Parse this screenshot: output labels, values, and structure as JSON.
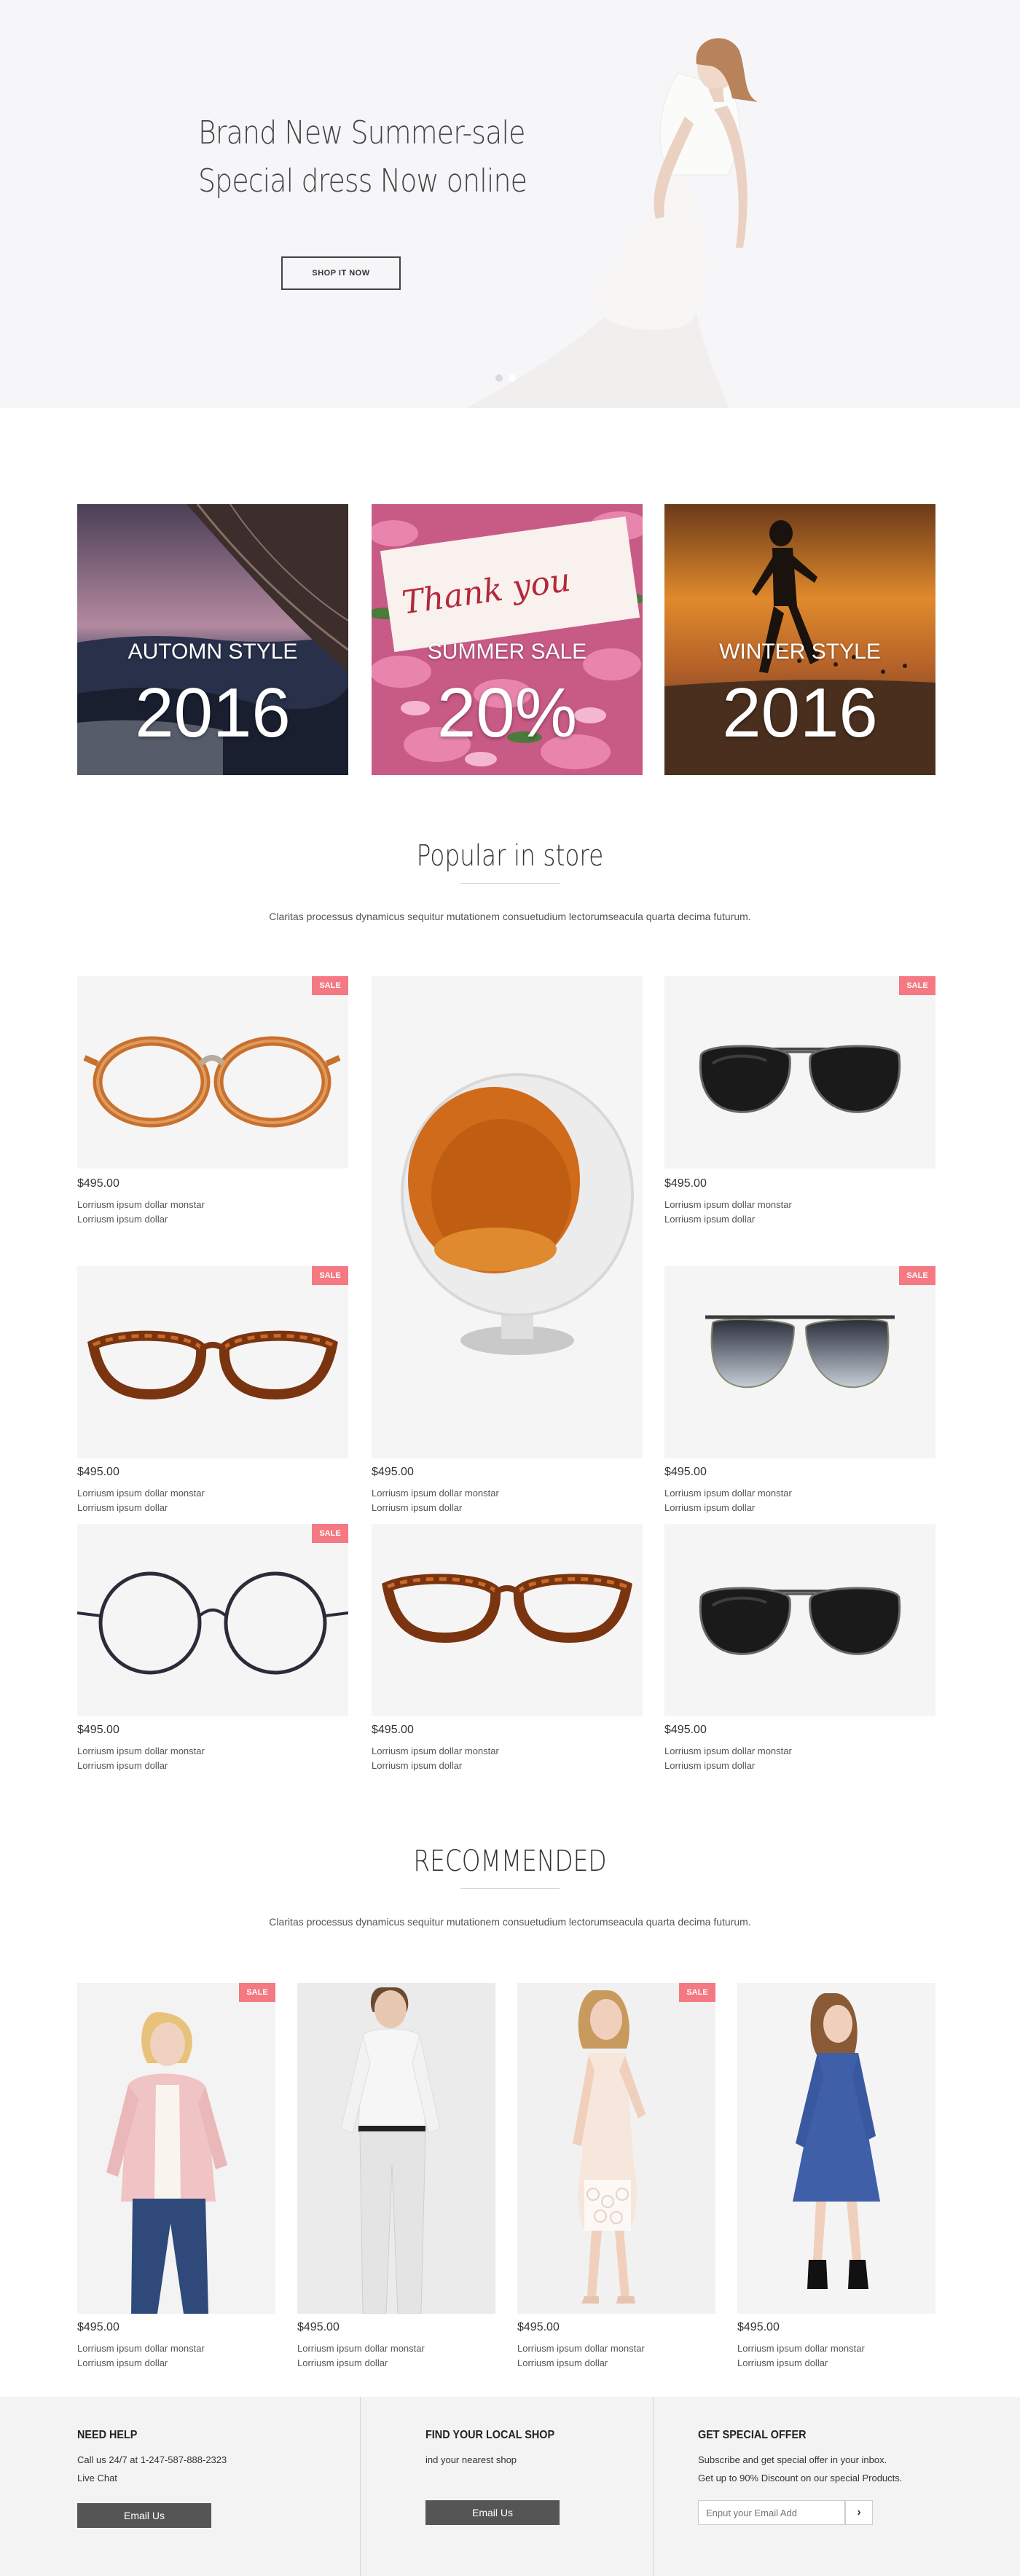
{
  "hero": {
    "title_line1": "Brand New Summer-sale",
    "title_line2": "Special dress Now online",
    "button": "SHOP IT NOW"
  },
  "banners": [
    {
      "title": "AUTOMN STYLE",
      "big": "2016"
    },
    {
      "title": "SUMMER SALE",
      "big": "20%",
      "card_text": "Thank you"
    },
    {
      "title": "WINTER STYLE",
      "big": "2016"
    }
  ],
  "popular": {
    "title": "Popular in store",
    "subtitle": "Claritas processus dynamicus sequitur mutationem consuetudium lectorumseacula quarta decima futurum.",
    "products": [
      {
        "price": "$495.00",
        "line1": "Lorriusm ipsum dollar monstar",
        "line2": "Lorriusm ipsum dollar",
        "sale": "SALE",
        "icon": "tortoise-glasses-icon"
      },
      {
        "price": "$495.00",
        "line1": "Lorriusm ipsum dollar monstar",
        "line2": "Lorriusm ipsum dollar",
        "sale": "",
        "icon": "egg-chair-icon"
      },
      {
        "price": "$495.00",
        "line1": "Lorriusm ipsum dollar monstar",
        "line2": "Lorriusm ipsum dollar",
        "sale": "SALE",
        "icon": "aviator-sunglasses-icon"
      },
      {
        "price": "$495.00",
        "line1": "Lorriusm ipsum dollar monstar",
        "line2": "Lorriusm ipsum dollar",
        "sale": "SALE",
        "icon": "cat-eye-glasses-icon"
      },
      {
        "price": "$495.00",
        "line1": "Lorriusm ipsum dollar monstar",
        "line2": "Lorriusm ipsum dollar",
        "sale": "SALE",
        "icon": "gradient-sunglasses-icon"
      },
      {
        "price": "$495.00",
        "line1": "Lorriusm ipsum dollar monstar",
        "line2": "Lorriusm ipsum dollar",
        "sale": "SALE",
        "icon": "round-wire-glasses-icon"
      },
      {
        "price": "$495.00",
        "line1": "Lorriusm ipsum dollar monstar",
        "line2": "Lorriusm ipsum dollar",
        "sale": "",
        "icon": "cat-eye-glasses-icon"
      },
      {
        "price": "$495.00",
        "line1": "Lorriusm ipsum dollar monstar",
        "line2": "Lorriusm ipsum dollar",
        "sale": "",
        "icon": "aviator-sunglasses-icon"
      }
    ]
  },
  "recommended": {
    "title": "RECOMMENDED",
    "subtitle": "Claritas processus dynamicus sequitur mutationem consuetudium lectorumseacula quarta decima futurum.",
    "products": [
      {
        "price": "$495.00",
        "line1": "Lorriusm ipsum dollar monstar",
        "line2": "Lorriusm ipsum dollar",
        "sale": "SALE",
        "icon": "pink-jacket-model-icon"
      },
      {
        "price": "$495.00",
        "line1": "Lorriusm ipsum dollar monstar",
        "line2": "Lorriusm ipsum dollar",
        "sale": "",
        "icon": "white-shirt-model-icon"
      },
      {
        "price": "$495.00",
        "line1": "Lorriusm ipsum dollar monstar",
        "line2": "Lorriusm ipsum dollar",
        "sale": "SALE",
        "icon": "lace-dress-model-icon"
      },
      {
        "price": "$495.00",
        "line1": "Lorriusm ipsum dollar monstar",
        "line2": "Lorriusm ipsum dollar",
        "sale": "",
        "icon": "denim-dress-model-icon"
      }
    ]
  },
  "footer": {
    "help": {
      "title": "NEED HELP",
      "line1": "Call us 24/7 at 1-247-587-888-2323",
      "line2": "Live Chat",
      "button": "Email Us"
    },
    "shop": {
      "title": "FIND YOUR LOCAL SHOP",
      "line1": "ind your nearest shop",
      "button": "Email Us"
    },
    "offer": {
      "title": "GET SPECIAL OFFER",
      "line1": "Subscribe and get special offer in your inbox.",
      "line2": "Get up to 90% Discount on our special Products.",
      "placeholder": "Enput your Email Add",
      "submit_icon": "chevron-right-icon"
    }
  },
  "colors": {
    "sale_badge": "#f47983",
    "hero_bg": "#f6f5f8",
    "footer_bg": "#f3f3f3",
    "button_dark": "#555555"
  }
}
